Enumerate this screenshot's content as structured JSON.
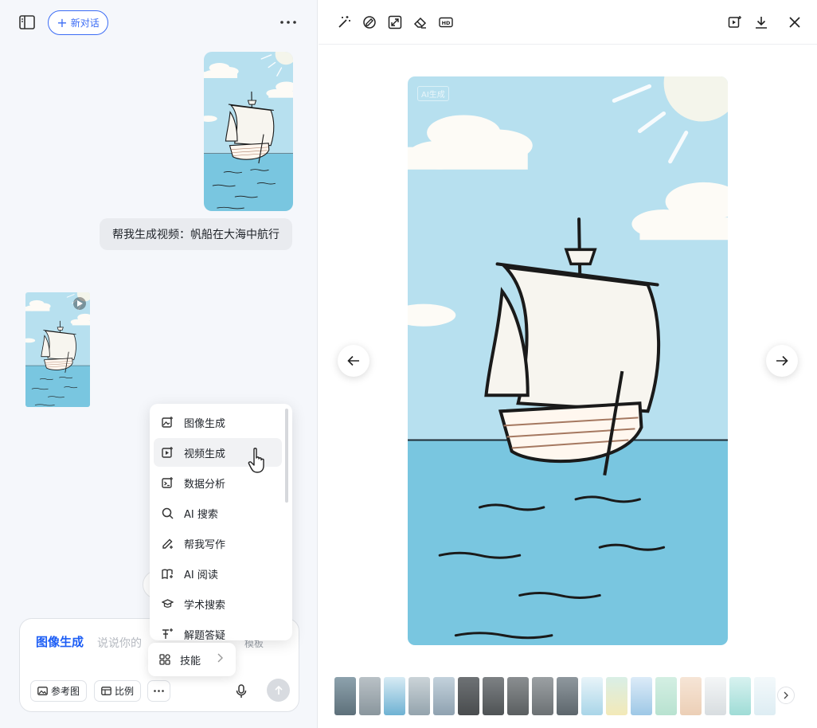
{
  "chat": {
    "new_chat_label": "新对话",
    "user_message": "帮我生成视频：帆船在大海中航行"
  },
  "composer": {
    "mode_label": "图像生成",
    "placeholder": "说说你的",
    "template_label": "模板",
    "reference_label": "参考图",
    "ratio_label": "比例"
  },
  "skill_menu": {
    "items": [
      {
        "label": "图像生成",
        "icon": "image-gen-icon"
      },
      {
        "label": "视频生成",
        "icon": "video-gen-icon",
        "active": true
      },
      {
        "label": "数据分析",
        "icon": "data-analysis-icon"
      },
      {
        "label": "AI 搜索",
        "icon": "ai-search-icon"
      },
      {
        "label": "帮我写作",
        "icon": "writing-icon"
      },
      {
        "label": "AI 阅读",
        "icon": "reading-icon"
      },
      {
        "label": "学术搜索",
        "icon": "academic-icon"
      },
      {
        "label": "解题答疑",
        "icon": "problem-solving-icon"
      }
    ],
    "skills_label": "技能"
  },
  "viewer": {
    "watermark": "AI生成",
    "toolbar_left": [
      "magic-wand-icon",
      "brush-edit-icon",
      "expand-icon",
      "eraser-icon",
      "hd-icon"
    ],
    "toolbar_right": [
      "video-icon",
      "download-icon",
      "close-icon"
    ]
  },
  "colors": {
    "accent": "#3b6cf5",
    "sky": "#b7e0ef",
    "sea": "#78c7e1"
  }
}
